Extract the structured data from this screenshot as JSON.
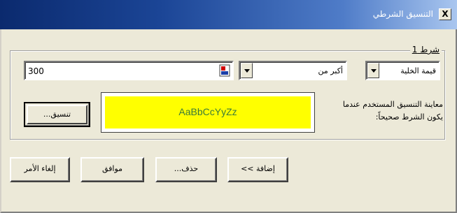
{
  "window": {
    "title": "التنسيق الشرطي",
    "close_label": "X"
  },
  "condition_group": {
    "label": "شرط 1",
    "condition_type": "قيمة الخلية",
    "operator": "أكبر من",
    "value": "300"
  },
  "preview": {
    "sample_text": "AaBbCcYyZz",
    "caption": "معاينة التنسيق المستخدم عندما يكون الشرط صحيحاً:",
    "background_color": "#ffff00"
  },
  "buttons": {
    "format": "تنسيق...",
    "add": "إضافة >>",
    "delete": "حذف...",
    "ok": "موافق",
    "cancel": "إلغاء الأمر"
  }
}
